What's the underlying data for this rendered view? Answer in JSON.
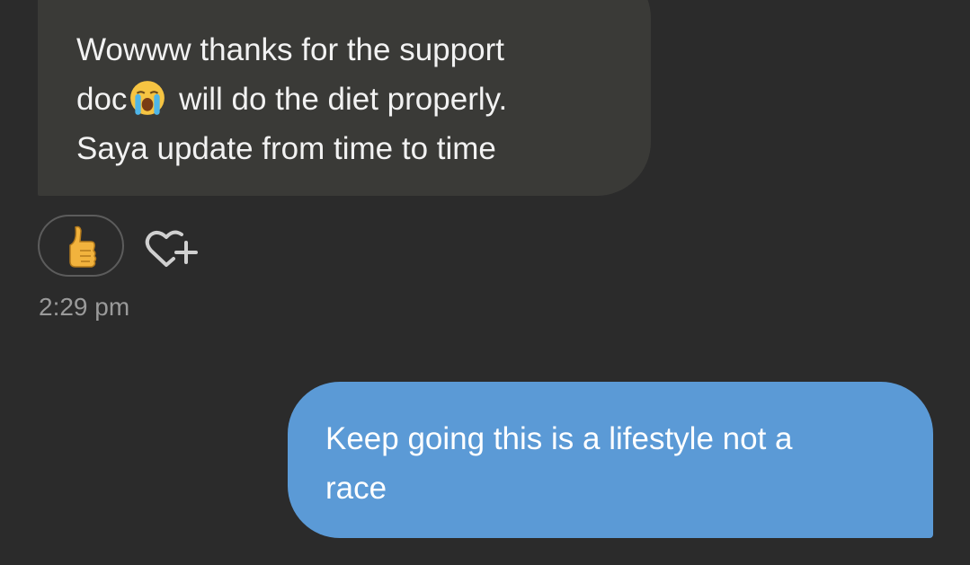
{
  "received_message": {
    "line1": "Wowww thanks for the support",
    "line2_before_emoji": "doc",
    "emoji": "loudly-crying-face-emoji",
    "line2_after_emoji": " will do the diet properly.",
    "line3": "Saya update from time to time",
    "bubble_color": "#3a3a37"
  },
  "reaction": {
    "emoji": "thumbs-up-emoji",
    "add_reaction_icon": "heart-plus-icon"
  },
  "timestamp": "2:29 pm",
  "sent_message": {
    "line1": "Keep going this is a lifestyle not a",
    "line2": "race",
    "bubble_color": "#5b9ad6"
  },
  "colors": {
    "background": "#2b2b2b",
    "timestamp": "#9a9a9a"
  }
}
